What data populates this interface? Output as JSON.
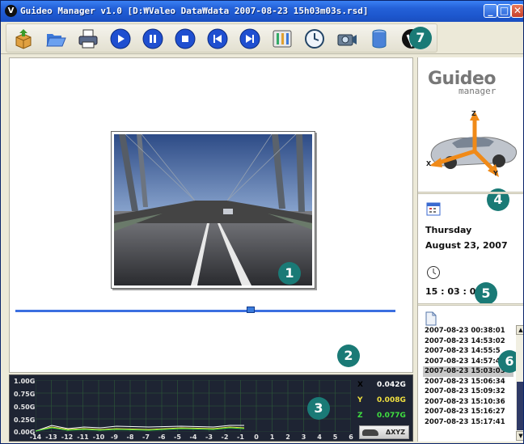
{
  "window": {
    "title": "Guideo Manager v1.0  [D:₩Valeo Data₩data 2007-08-23 15h03m03s.rsd]",
    "controls": {
      "minimize": "_",
      "maximize": "□",
      "close": "✕"
    },
    "app_icon_letter": "V"
  },
  "toolbar": {
    "buttons": [
      {
        "icon": "package-icon",
        "color": "#3a9a2a"
      },
      {
        "icon": "open-folder-icon",
        "color": "#3c78d8"
      },
      {
        "icon": "print-icon",
        "color": "#445"
      },
      {
        "icon": "play-icon",
        "color": "#1f4fd0"
      },
      {
        "icon": "pause-icon",
        "color": "#1f4fd0"
      },
      {
        "icon": "stop-icon",
        "color": "#1f4fd0"
      },
      {
        "icon": "skip-back-icon",
        "color": "#1f4fd0"
      },
      {
        "icon": "skip-forward-icon",
        "color": "#1f4fd0"
      },
      {
        "icon": "settings-tools-icon",
        "color": "#3a6"
      },
      {
        "icon": "clock-settings-icon",
        "color": "#246"
      },
      {
        "icon": "camera-icon",
        "color": "#357"
      },
      {
        "icon": "database-icon",
        "color": "#26a"
      },
      {
        "icon": "valeo-logo-icon",
        "color": "#111"
      }
    ]
  },
  "callouts": [
    "1",
    "2",
    "3",
    "4",
    "5",
    "6",
    "7"
  ],
  "playback": {
    "position_fraction": 0.62
  },
  "graph": {
    "y_labels": [
      "1.00G",
      "0.75G",
      "0.50G",
      "0.25G",
      "0.00G"
    ],
    "x_labels": [
      "-14",
      "-13",
      "-12",
      "-11",
      "-10",
      "-9",
      "-8",
      "-7",
      "-6",
      "-5",
      "-4",
      "-3",
      "-2",
      "-1",
      "0",
      "1",
      "2",
      "3",
      "4",
      "5",
      "6"
    ],
    "axes": [
      {
        "label": "X",
        "value": "0.042G",
        "color": "#ffffff"
      },
      {
        "label": "Y",
        "value": "0.008G",
        "color": "#f0e040"
      },
      {
        "label": "Z",
        "value": "0.077G",
        "color": "#40e040"
      }
    ],
    "delta_button": "ΔXYZ",
    "grid_color": "#2e5a3a"
  },
  "right_panel": {
    "logo_main": "Guideo",
    "logo_sub": "manager",
    "axis_labels": {
      "x": "X",
      "y": "Y",
      "z": "Z"
    },
    "day": "Thursday",
    "date": "August  23,  2007",
    "time": "15 : 03 : 01",
    "logs": [
      "2007-08-23 00:38:01",
      "2007-08-23 14:53:02",
      "2007-08-23 14:55:5",
      "2007-08-23 14:57:49",
      "2007-08-23 15:03:03",
      "2007-08-23 15:06:34",
      "2007-08-23 15:09:32",
      "2007-08-23 15:10:36",
      "2007-08-23 15:16:27",
      "2007-08-23 15:17:41"
    ],
    "selected_log_index": 4
  }
}
